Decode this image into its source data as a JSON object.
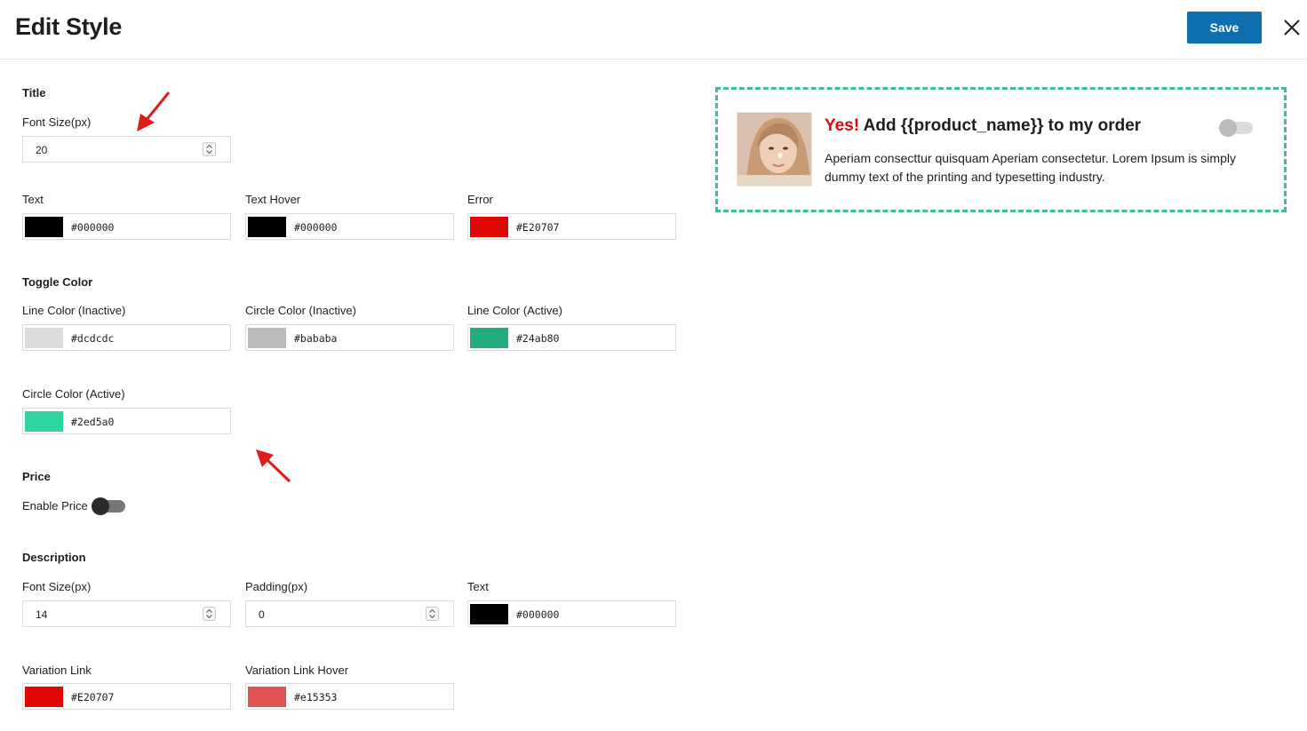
{
  "header": {
    "title": "Edit Style",
    "save_label": "Save"
  },
  "title_section": {
    "heading": "Title",
    "font_size": {
      "label": "Font Size(px)",
      "value": "20"
    },
    "text": {
      "label": "Text",
      "value": "#000000"
    },
    "text_hover": {
      "label": "Text Hover",
      "value": "#000000"
    },
    "error": {
      "label": "Error",
      "value": "#E20707"
    }
  },
  "toggle_section": {
    "heading": "Toggle Color",
    "line_inactive": {
      "label": "Line Color (Inactive)",
      "value": "#dcdcdc"
    },
    "circle_inactive": {
      "label": "Circle Color (Inactive)",
      "value": "#bababa"
    },
    "line_active": {
      "label": "Line Color (Active)",
      "value": "#24ab80"
    },
    "circle_active": {
      "label": "Circle Color (Active)",
      "value": "#2ed5a0"
    }
  },
  "price_section": {
    "heading": "Price",
    "enable_label": "Enable Price",
    "enabled": false
  },
  "description_section": {
    "heading": "Description",
    "font_size": {
      "label": "Font Size(px)",
      "value": "14"
    },
    "padding": {
      "label": "Padding(px)",
      "value": "0"
    },
    "text": {
      "label": "Text",
      "value": "#000000"
    },
    "variation_link": {
      "label": "Variation Link",
      "value": "#E20707"
    },
    "variation_link_hover": {
      "label": "Variation Link Hover",
      "value": "#e15353"
    }
  },
  "preview": {
    "title_yes": "Yes!",
    "title_rest": " Add {{product_name}} to my order",
    "description": "Aperiam consecttur quisquam Aperiam consectetur. Lorem Ipsum is simply dummy text of the printing and typesetting industry.",
    "toggle_on": false
  },
  "colors": {
    "accent": "#0e6fb0",
    "preview_border": "#3fbf96",
    "arrow": "#e01b1b"
  }
}
